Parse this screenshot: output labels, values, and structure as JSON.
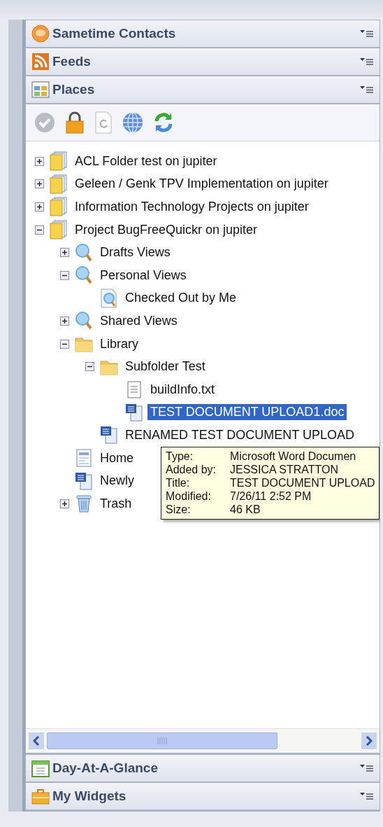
{
  "top_sections": [
    {
      "kind": "contacts",
      "title": "Sametime Contacts"
    },
    {
      "kind": "feeds",
      "title": "Feeds"
    },
    {
      "kind": "places",
      "title": "Places"
    }
  ],
  "tree": [
    {
      "kind": "place",
      "label": "ACL Folder test on jupiter",
      "expanded": false,
      "selected": false
    },
    {
      "kind": "place",
      "label": "Geleen / Genk TPV Implementation on jupiter",
      "expanded": false,
      "selected": false
    },
    {
      "kind": "place",
      "label": "Information Technology Projects on jupiter",
      "expanded": false,
      "selected": false
    },
    {
      "kind": "place",
      "label": "Project BugFreeQuickr on jupiter",
      "expanded": true,
      "selected": false,
      "children": [
        {
          "kind": "view",
          "label": "Drafts Views",
          "expanded": false,
          "selected": false
        },
        {
          "kind": "view",
          "label": "Personal Views",
          "expanded": true,
          "selected": false,
          "children": [
            {
              "kind": "view-doc",
              "label": "Checked Out by Me",
              "selected": false
            }
          ]
        },
        {
          "kind": "view",
          "label": "Shared Views",
          "expanded": false,
          "selected": false
        },
        {
          "kind": "folder",
          "label": "Library",
          "expanded": true,
          "selected": false,
          "children": [
            {
              "kind": "folder",
              "label": "Subfolder Test",
              "expanded": true,
              "selected": false,
              "children": [
                {
                  "kind": "text",
                  "label": "buildInfo.txt",
                  "selected": false
                },
                {
                  "kind": "word",
                  "label": "TEST DOCUMENT UPLOAD1.doc",
                  "selected": true
                }
              ]
            },
            {
              "kind": "word",
              "label": "RENAMED TEST DOCUMENT UPLOAD",
              "selected": false
            }
          ]
        },
        {
          "kind": "page",
          "label": "Home",
          "selected": false
        },
        {
          "kind": "word",
          "label": "Newly",
          "selected": false
        },
        {
          "kind": "trash",
          "label": "Trash",
          "expanded": false,
          "selected": false
        }
      ]
    }
  ],
  "tooltip": [
    {
      "label": "Type:",
      "value": "Microsoft Word Documen"
    },
    {
      "label": "Added by:",
      "value": "JESSICA STRATTON"
    },
    {
      "label": "Title:",
      "value": "TEST DOCUMENT UPLOAD"
    },
    {
      "label": "Modified:",
      "value": "7/26/11 2:52 PM"
    },
    {
      "label": "Size:",
      "value": "46 KB"
    }
  ],
  "bottom_sections": [
    {
      "kind": "calendar",
      "title": "Day-At-A-Glance"
    },
    {
      "kind": "widgets",
      "title": "My Widgets"
    }
  ]
}
